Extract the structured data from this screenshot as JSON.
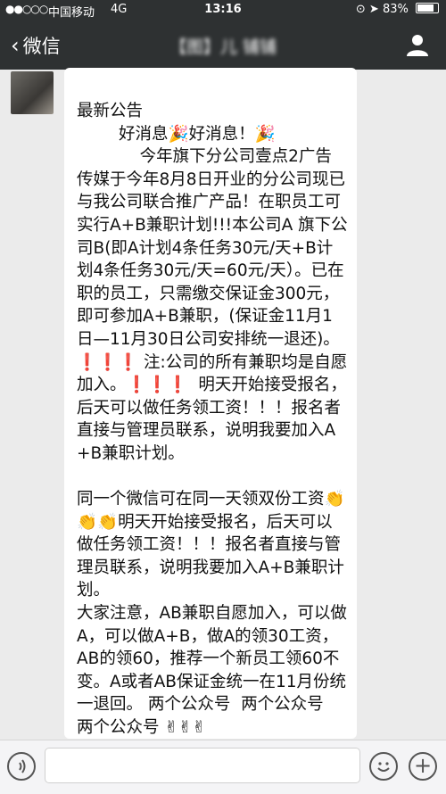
{
  "status_bar": {
    "signal": "●●○○○",
    "carrier": "中国移动",
    "network": "4G",
    "time": "13:16",
    "battery": "83%",
    "battery_level": 0.83
  },
  "nav": {
    "back_label": "微信",
    "chat_title": "【图】儿 铺铺",
    "icons": {
      "back": "chevron-left-icon",
      "profile": "person-icon"
    }
  },
  "message": {
    "text": "最新公告\n        好消息🎉好消息！🎉\n            今年旗下分公司壹点2广告传媒于今年8月8日开业的分公司现已与我公司联合推广产品！在职员工可实行A+B兼职计划!!!本公司A 旗下公司B(即A计划4条任务30元/天+B计划4条任务30元/天=60元/天）。已在职的员工，只需缴交保证金300元，即可参加A+B兼职，(保证金11月1日—11月30日公司安排统一退还)。\n❗❗❗ 注:公司的所有兼职均是自愿加入。❗❗❗  明天开始接受报名，后天可以做任务领工资！！！报名者直接与管理员联系，说明我要加入A+B兼职计划。\n\n同一个微信可在同一天领双份工资👏👏👏明天开始接受报名，后天可以做任务领工资！！！报名者直接与管理员联系，说明我要加入A+B兼职计划。\n大家注意，AB兼职自愿加入，可以做A，可以做A+B，做A的领30工资，AB的领60，推荐一个新员工领60不变。A或者AB保证金统一在11月份统一退回。 两个公众号  两个公众号  两个公众号 ✌✌✌"
  },
  "input_bar": {
    "icons": {
      "voice": "voice-icon",
      "emoji": "emoji-icon",
      "more": "plus-icon"
    }
  }
}
